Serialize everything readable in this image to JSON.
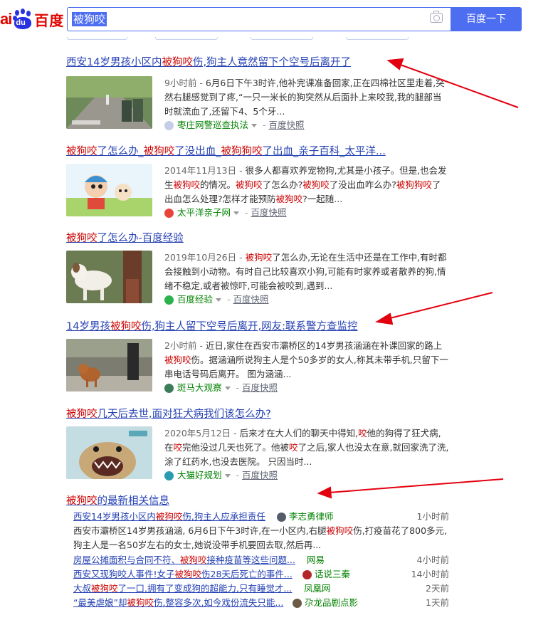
{
  "search": {
    "query": "被狗咬",
    "button_label": "百度一下"
  },
  "logo": {
    "prefix": "ai",
    "paw_text": "du",
    "zh": "百度"
  },
  "results": [
    {
      "title_parts": [
        [
          "西安14岁男孩小区内",
          0
        ],
        [
          "被狗咬",
          1
        ],
        [
          "伤,狗主人竟然留下个空号后离开了",
          0
        ]
      ],
      "snippet_parts": [
        [
          "9小时前 - ",
          2
        ],
        [
          "6月6日下午3时许,他补完课准备回家,正在四棉社区里走着,突然右腿感觉到了疼,“一只一米长的狗突然从后面扑上来咬我,我的腿部当时就流血了,还留下4、5个牙...",
          0
        ]
      ],
      "source": "枣庄网警巡查执法",
      "cache": "百度快照"
    },
    {
      "title_parts": [
        [
          "被狗咬",
          1
        ],
        [
          "了怎么办_",
          0
        ],
        [
          "被狗咬",
          1
        ],
        [
          "了没出血_",
          0
        ],
        [
          "被狗狗咬",
          1
        ],
        [
          "了出血_亲子百科_太平洋...",
          0
        ]
      ],
      "snippet_parts": [
        [
          "2014年11月13日 - ",
          2
        ],
        [
          "很多人都喜欢养宠物狗,尤其是小孩子。但是,也会发生",
          0
        ],
        [
          "被狗咬",
          1
        ],
        [
          "的情况。",
          0
        ],
        [
          "被狗咬",
          1
        ],
        [
          "了怎么办?",
          0
        ],
        [
          "被狗咬",
          1
        ],
        [
          "了没出血咋么办?",
          0
        ],
        [
          "被狗狗咬",
          1
        ],
        [
          "了出血怎么处理?怎样才能预防",
          0
        ],
        [
          "被狗咬",
          1
        ],
        [
          "?一起随...",
          0
        ]
      ],
      "source": "太平洋亲子网",
      "cache": "百度快照"
    },
    {
      "title_parts": [
        [
          "被狗咬",
          1
        ],
        [
          "了怎么办-百度经验",
          0
        ]
      ],
      "snippet_parts": [
        [
          "2019年10月26日 - ",
          2
        ],
        [
          "被狗咬",
          1
        ],
        [
          "了怎么办,无论在生活中还是在工作中,有时都会接触到小动物。有时自己比较喜欢小狗,可能有时家养或者散养的狗,情绪不稳定,或者被惊吓,可能会被咬到,遇到...",
          0
        ]
      ],
      "source": "百度经验",
      "cache": "百度快照"
    },
    {
      "title_parts": [
        [
          "14岁男孩",
          0
        ],
        [
          "被狗咬",
          1
        ],
        [
          "伤,狗主人留下空号后离开,网友:联系警方查监控",
          0
        ]
      ],
      "snippet_parts": [
        [
          "2小时前 - ",
          2
        ],
        [
          "近日,家住在西安市灞桥区的14岁男孩涵涵在补课回家的路上",
          0
        ],
        [
          "被狗咬",
          1
        ],
        [
          "伤。据涵涵所说狗主人是个50多岁的女人,称其未带手机,只留下一串电话号码后离开。 图为涵涵...",
          0
        ]
      ],
      "source": "斑马大观察",
      "cache": "百度快照"
    },
    {
      "title_parts": [
        [
          "被狗咬",
          1
        ],
        [
          "几天后去世,面对狂犬病我们该怎么办?",
          0
        ]
      ],
      "snippet_parts": [
        [
          "2020年5月12日 - ",
          2
        ],
        [
          "后来才在大人们的聊天中得知,",
          0
        ],
        [
          "咬",
          1
        ],
        [
          "他的狗得了狂犬病,在",
          0
        ],
        [
          "咬",
          1
        ],
        [
          "完他没过几天也死了。他被",
          0
        ],
        [
          "咬",
          1
        ],
        [
          "了之后,家人也没太在意,就回家洗了洗,涂了红药水,也没去医院。 只因当时...",
          0
        ]
      ],
      "source": "大猫好规划",
      "cache": "百度快照"
    }
  ],
  "news": {
    "title_parts": [
      [
        "被狗咬",
        1
      ],
      [
        "的最新相关信息",
        0
      ]
    ],
    "items": [
      {
        "title_parts": [
          [
            "西安14岁男孩小区内",
            0
          ],
          [
            "被狗咬",
            1
          ],
          [
            "伤,狗主人应承担责任",
            0
          ]
        ],
        "source": "李志勇律师",
        "time": "1小时前"
      },
      {
        "title_parts": [
          [
            "房屋公摊面积与合同不符、",
            0
          ],
          [
            "被狗咬",
            1
          ],
          [
            "接种疫苗等这些问题...",
            0
          ]
        ],
        "source": "网易",
        "time": "4小时前"
      },
      {
        "title_parts": [
          [
            "西安又现狗咬人事件!女子",
            0
          ],
          [
            "被狗咬",
            1
          ],
          [
            "伤28天后死亡的事件...",
            0
          ]
        ],
        "source": "话说三秦",
        "time": "14小时前"
      },
      {
        "title_parts": [
          [
            "大叔",
            0
          ],
          [
            "被狗咬",
            1
          ],
          [
            "了一口,拥有了变成狗的超能力,只有睡觉才...",
            0
          ]
        ],
        "source": "凤凰网",
        "time": "2天前"
      },
      {
        "title_parts": [
          [
            "“最美虐娘”却",
            0
          ],
          [
            "被狗咬",
            1
          ],
          [
            "伤,整容多次,如今戏份流失只能...",
            0
          ]
        ],
        "source": "尕龙品剧点影",
        "time": "1天前"
      }
    ],
    "first_snippet_parts": [
      [
        "西安市灞桥区14岁男孩涵涵, 6月6日下午3时许,在一小区内,右腿",
        0
      ],
      [
        "被狗咬",
        1
      ],
      [
        "伤,打疫苗花了800多元,狗主人是一名50岁左右的女士,她说没带手机要回去取,然后再...",
        0
      ]
    ]
  },
  "colors": {
    "link": "#2440b3",
    "highlight": "#c00",
    "source_green": "#008000",
    "brand_blue": "#4e6ef2",
    "arrow_red": "#e3000f"
  }
}
